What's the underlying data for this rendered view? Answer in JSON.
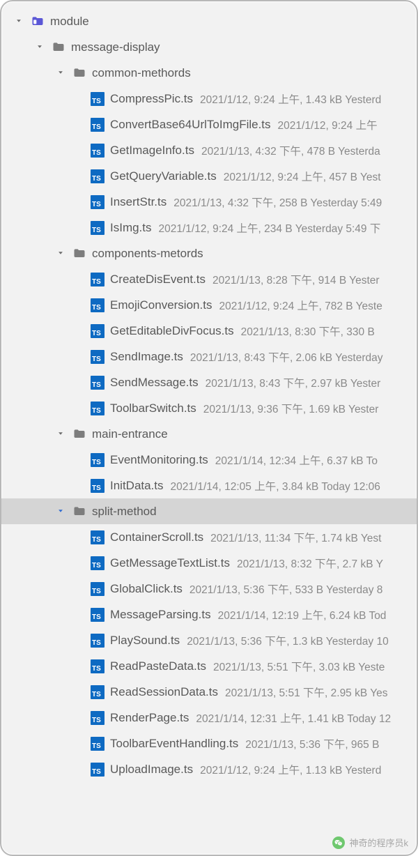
{
  "watermark": "神奇的程序员k",
  "tree": [
    {
      "depth": 0,
      "kind": "module-folder",
      "chevron": "down",
      "label": "module"
    },
    {
      "depth": 1,
      "kind": "folder",
      "chevron": "down",
      "label": "message-display"
    },
    {
      "depth": 2,
      "kind": "folder",
      "chevron": "down",
      "label": "common-methords"
    },
    {
      "depth": 3,
      "kind": "ts",
      "label": "CompressPic.ts",
      "meta": "2021/1/12, 9:24 上午, 1.43 kB Yesterd"
    },
    {
      "depth": 3,
      "kind": "ts",
      "label": "ConvertBase64UrlToImgFile.ts",
      "meta": "2021/1/12, 9:24 上午"
    },
    {
      "depth": 3,
      "kind": "ts",
      "label": "GetImageInfo.ts",
      "meta": "2021/1/13, 4:32 下午, 478 B Yesterda"
    },
    {
      "depth": 3,
      "kind": "ts",
      "label": "GetQueryVariable.ts",
      "meta": "2021/1/12, 9:24 上午, 457 B Yest"
    },
    {
      "depth": 3,
      "kind": "ts",
      "label": "InsertStr.ts",
      "meta": "2021/1/13, 4:32 下午, 258 B Yesterday 5:49"
    },
    {
      "depth": 3,
      "kind": "ts",
      "label": "IsImg.ts",
      "meta": "2021/1/12, 9:24 上午, 234 B Yesterday 5:49 下"
    },
    {
      "depth": 2,
      "kind": "folder",
      "chevron": "down",
      "label": "components-metords"
    },
    {
      "depth": 3,
      "kind": "ts",
      "label": "CreateDisEvent.ts",
      "meta": "2021/1/13, 8:28 下午, 914 B Yester"
    },
    {
      "depth": 3,
      "kind": "ts",
      "label": "EmojiConversion.ts",
      "meta": "2021/1/12, 9:24 上午, 782 B Yeste"
    },
    {
      "depth": 3,
      "kind": "ts",
      "label": "GetEditableDivFocus.ts",
      "meta": "2021/1/13, 8:30 下午, 330 B"
    },
    {
      "depth": 3,
      "kind": "ts",
      "label": "SendImage.ts",
      "meta": "2021/1/13, 8:43 下午, 2.06 kB Yesterday"
    },
    {
      "depth": 3,
      "kind": "ts",
      "label": "SendMessage.ts",
      "meta": "2021/1/13, 8:43 下午, 2.97 kB Yester"
    },
    {
      "depth": 3,
      "kind": "ts",
      "label": "ToolbarSwitch.ts",
      "meta": "2021/1/13, 9:36 下午, 1.69 kB Yester"
    },
    {
      "depth": 2,
      "kind": "folder",
      "chevron": "down",
      "label": "main-entrance"
    },
    {
      "depth": 3,
      "kind": "ts",
      "label": "EventMonitoring.ts",
      "meta": "2021/1/14, 12:34 上午, 6.37 kB To"
    },
    {
      "depth": 3,
      "kind": "ts",
      "label": "InitData.ts",
      "meta": "2021/1/14, 12:05 上午, 3.84 kB Today 12:06"
    },
    {
      "depth": 2,
      "kind": "folder",
      "chevron": "down",
      "label": "split-method",
      "selected": true
    },
    {
      "depth": 3,
      "kind": "ts",
      "label": "ContainerScroll.ts",
      "meta": "2021/1/13, 11:34 下午, 1.74 kB Yest"
    },
    {
      "depth": 3,
      "kind": "ts",
      "label": "GetMessageTextList.ts",
      "meta": "2021/1/13, 8:32 下午, 2.7 kB Y"
    },
    {
      "depth": 3,
      "kind": "ts",
      "label": "GlobalClick.ts",
      "meta": "2021/1/13, 5:36 下午, 533 B Yesterday 8"
    },
    {
      "depth": 3,
      "kind": "ts",
      "label": "MessageParsing.ts",
      "meta": "2021/1/14, 12:19 上午, 6.24 kB Tod"
    },
    {
      "depth": 3,
      "kind": "ts",
      "label": "PlaySound.ts",
      "meta": "2021/1/13, 5:36 下午, 1.3 kB Yesterday 10"
    },
    {
      "depth": 3,
      "kind": "ts",
      "label": "ReadPasteData.ts",
      "meta": "2021/1/13, 5:51 下午, 3.03 kB Yeste"
    },
    {
      "depth": 3,
      "kind": "ts",
      "label": "ReadSessionData.ts",
      "meta": "2021/1/13, 5:51 下午, 2.95 kB Yes"
    },
    {
      "depth": 3,
      "kind": "ts",
      "label": "RenderPage.ts",
      "meta": "2021/1/14, 12:31 上午, 1.41 kB Today 12"
    },
    {
      "depth": 3,
      "kind": "ts",
      "label": "ToolbarEventHandling.ts",
      "meta": "2021/1/13, 5:36 下午, 965 B"
    },
    {
      "depth": 3,
      "kind": "ts",
      "label": "UploadImage.ts",
      "meta": "2021/1/12, 9:24 上午, 1.13 kB Yesterd"
    }
  ]
}
